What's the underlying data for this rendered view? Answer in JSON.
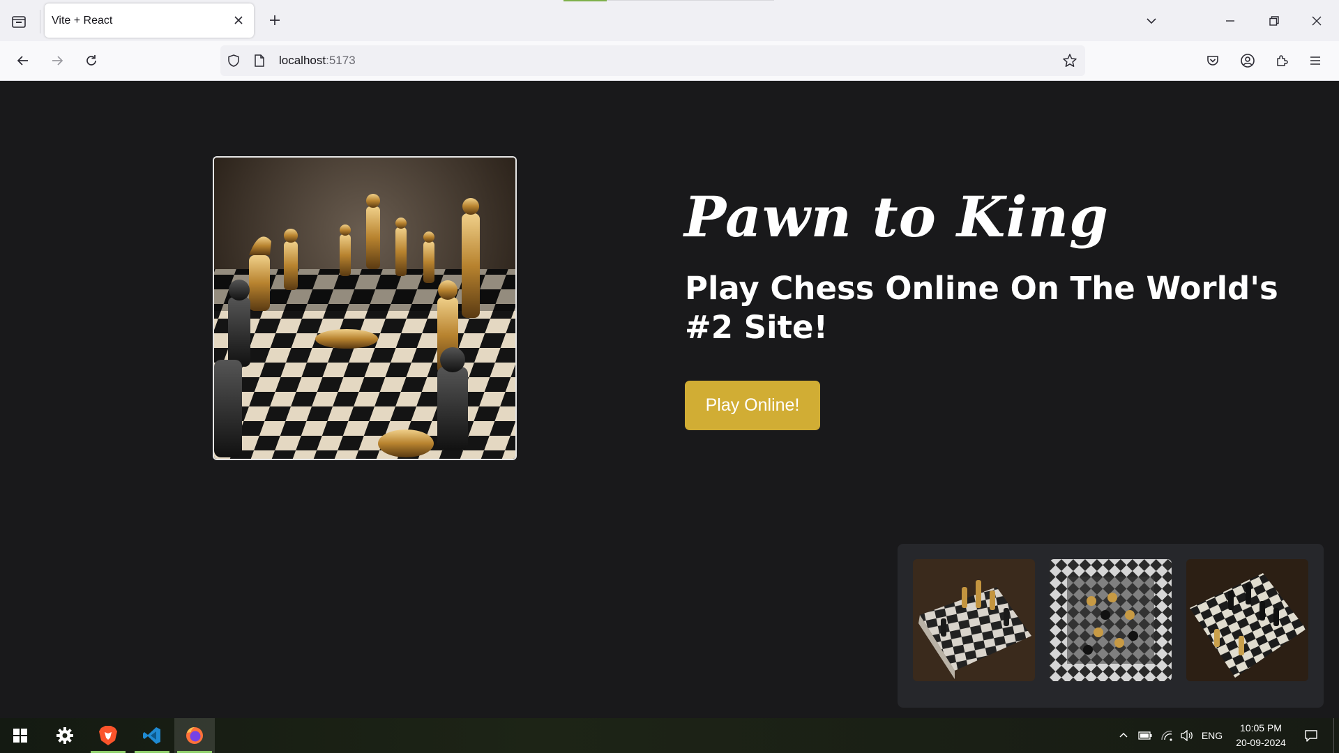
{
  "browser": {
    "tab": {
      "title": "Vite + React"
    },
    "address": {
      "host": "localhost",
      "port": ":5173"
    }
  },
  "page": {
    "brand": "Pawn to King",
    "headline": "Play Chess Online On The World's #2 Site!",
    "cta_label": "Play Online!",
    "accent_color": "#d1ad34",
    "background_color": "#19191b"
  },
  "taskbar": {
    "language": "ENG",
    "time": "10:05 PM",
    "date": "20-09-2024"
  }
}
